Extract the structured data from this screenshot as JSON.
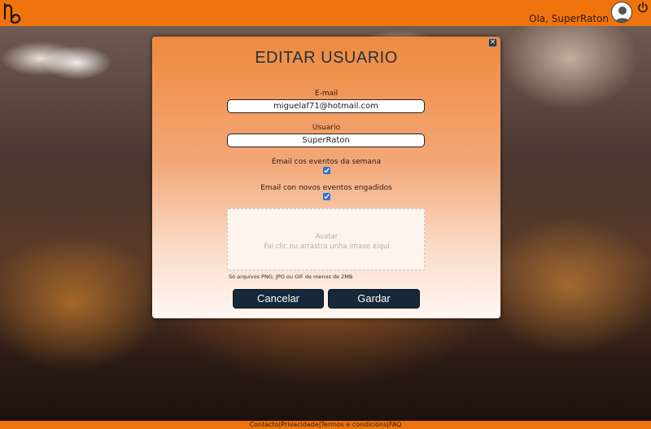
{
  "header": {
    "greeting": "Ola, SuperRaton",
    "logo_icon": "logo-mark-icon",
    "avatar_icon": "user-avatar-icon",
    "power_icon": "power-icon"
  },
  "modal": {
    "close_label": "×",
    "title": "EDITAR USUARIO",
    "email": {
      "label": "E-mail",
      "value": "miguelaf71@hotmail.com"
    },
    "username": {
      "label": "Usuario",
      "value": "SuperRaton"
    },
    "weekly_events": {
      "label": "Email cos eventos da semana",
      "checked": true
    },
    "new_events": {
      "label": "Email con novos eventos engadidos",
      "checked": true
    },
    "avatar_drop": {
      "title": "Avatar",
      "subtitle": "Fai clic ou arrastra unha imaxe eiquí"
    },
    "file_hint": "Só arquivos PNG, JPG ou GIF de menos de 2MB",
    "cancel_label": "Cancelar",
    "save_label": "Gardar"
  },
  "footer": {
    "links": [
      "Contacto",
      "Privacidade",
      "Termos e condicións",
      "FAQ"
    ],
    "separator": "|"
  },
  "colors": {
    "brand_orange": "#f0740e",
    "button_dark": "#16293a",
    "title_text": "#22323d"
  }
}
